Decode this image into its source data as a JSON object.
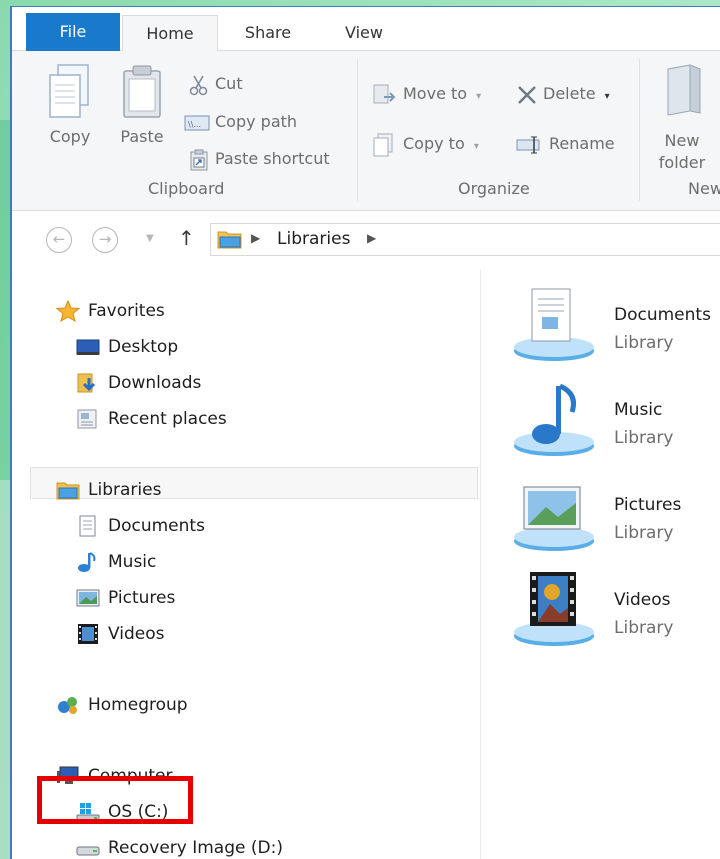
{
  "ribbon_tabs": {
    "file": "File",
    "home": "Home",
    "share": "Share",
    "view": "View"
  },
  "clipboard": {
    "copy": "Copy",
    "paste": "Paste",
    "cut": "Cut",
    "copy_path": "Copy path",
    "paste_shortcut": "Paste shortcut",
    "group_label": "Clipboard"
  },
  "organize": {
    "move_to": "Move to",
    "copy_to": "Copy to",
    "delete": "Delete",
    "rename": "Rename",
    "group_label": "Organize"
  },
  "new": {
    "new_folder_line1": "New",
    "new_folder_line2": "folder",
    "group_label": "New"
  },
  "address": {
    "path": "Libraries"
  },
  "nav": {
    "favorites": "Favorites",
    "desktop": "Desktop",
    "downloads": "Downloads",
    "recent_places": "Recent places",
    "libraries": "Libraries",
    "documents": "Documents",
    "music": "Music",
    "pictures": "Pictures",
    "videos": "Videos",
    "homegroup": "Homegroup",
    "computer": "Computer",
    "os_drive": "OS (C:)",
    "recovery_drive": "Recovery Image (D:)"
  },
  "libraries": [
    {
      "name": "Documents",
      "type": "Library"
    },
    {
      "name": "Music",
      "type": "Library"
    },
    {
      "name": "Pictures",
      "type": "Library"
    },
    {
      "name": "Videos",
      "type": "Library"
    }
  ],
  "colors": {
    "file_tab": "#1979ca",
    "highlight": "#e60000",
    "window_border": "#3a7ebf"
  }
}
